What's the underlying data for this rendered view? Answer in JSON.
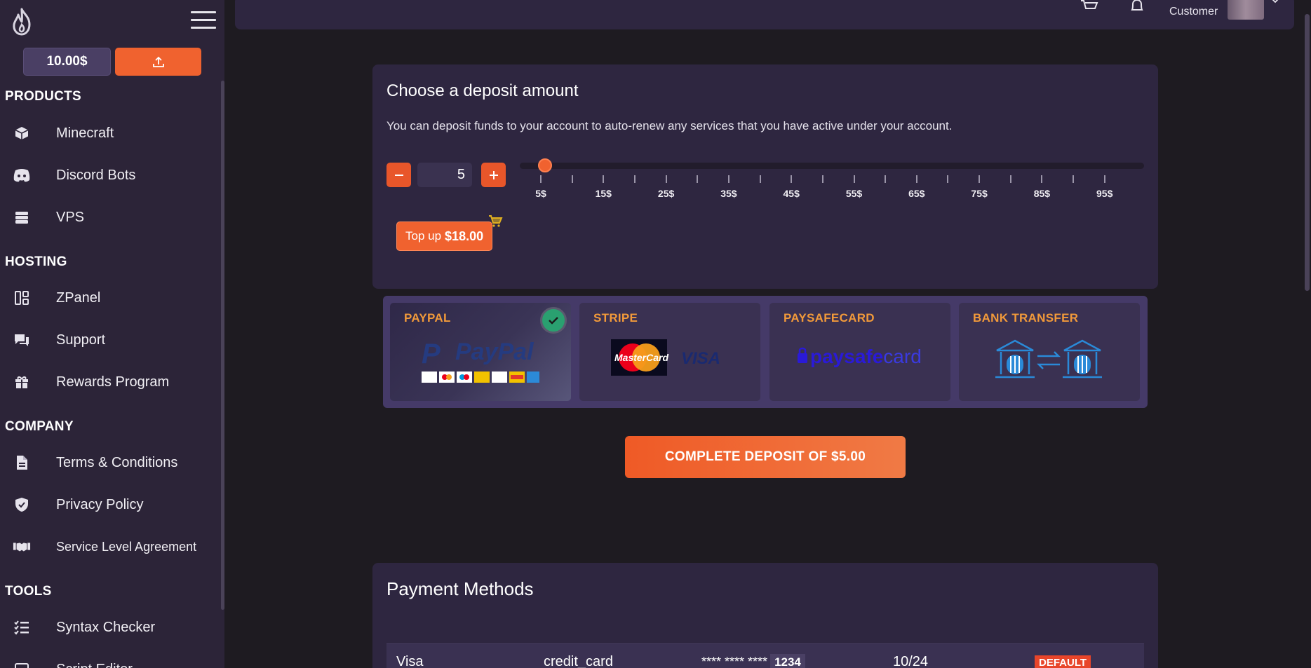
{
  "sidebar": {
    "balance": "10.00$",
    "sections": {
      "products": "PRODUCTS",
      "hosting": "HOSTING",
      "company": "COMPANY",
      "tools": "TOOLS"
    },
    "items": {
      "minecraft": "Minecraft",
      "discord_bots": "Discord Bots",
      "vps": "VPS",
      "zpanel": "ZPanel",
      "support": "Support",
      "rewards": "Rewards Program",
      "terms": "Terms & Conditions",
      "privacy": "Privacy Policy",
      "sla": "Service Level Agreement",
      "syntax_checker": "Syntax Checker",
      "script_editor": "Script Editor"
    }
  },
  "header": {
    "user_role": "Customer"
  },
  "deposit": {
    "title": "Choose a deposit amount",
    "description": "You can deposit funds to your account to auto-renew any services that you have active under your account.",
    "amount": "5",
    "slider_value": 5,
    "slider_min": 5,
    "slider_max": 100,
    "tick_labels": [
      "5$",
      "15$",
      "25$",
      "35$",
      "45$",
      "55$",
      "65$",
      "75$",
      "85$",
      "95$"
    ],
    "topup_prefix": "Top up",
    "topup_amount": "$18.00"
  },
  "payment_options": [
    {
      "name": "PAYPAL",
      "selected": true
    },
    {
      "name": "STRIPE",
      "selected": false
    },
    {
      "name": "PAYSAFECARD",
      "selected": false
    },
    {
      "name": "BANK TRANSFER",
      "selected": false
    }
  ],
  "logos": {
    "paypal": "PayPal",
    "mastercard": "MasterCard",
    "visa": "VISA",
    "paysafecard_1": "paysafe",
    "paysafecard_2": "card"
  },
  "complete_button": "COMPLETE DEPOSIT OF $5.00",
  "payment_methods": {
    "title": "Payment Methods",
    "rows": [
      {
        "brand": "Visa",
        "type": "credit_card",
        "masked": "**** **** ****",
        "last4": "1234",
        "expiry": "10/24",
        "badge": "DEFAULT"
      }
    ]
  },
  "colors": {
    "accent": "#f0622f",
    "sidebar_bg": "#2c2438",
    "card_bg": "#2e2640",
    "page_bg": "#1e1b21",
    "payment_name": "#f29a3a"
  }
}
